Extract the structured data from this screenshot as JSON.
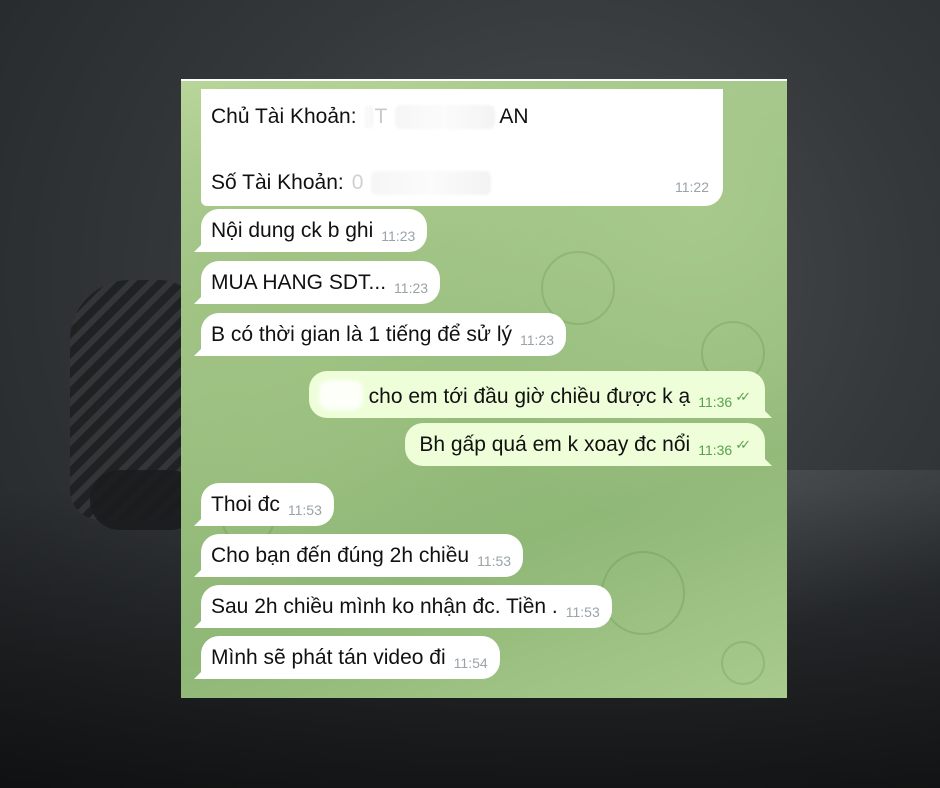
{
  "conversation": {
    "account_info": {
      "owner_label": "Chủ Tài Khoản:",
      "owner_fragment_a": "T",
      "owner_fragment_b": "AN",
      "number_label": "Số Tài Khoản:",
      "number_fragment": "0",
      "time": "11:22"
    },
    "messages": [
      {
        "direction": "in",
        "text": "Nội dung ck b ghi",
        "time": "11:23"
      },
      {
        "direction": "in",
        "text": "MUA HANG SDT...",
        "time": "11:23"
      },
      {
        "direction": "in",
        "text": "B có thời gian là 1 tiếng để sử lý",
        "time": "11:23"
      },
      {
        "direction": "out",
        "text": "cho em tới đầu giờ chiều được k ạ",
        "time": "11:36",
        "status": "read"
      },
      {
        "direction": "out",
        "text": "Bh gấp quá em k xoay đc nổi",
        "time": "11:36",
        "status": "read"
      },
      {
        "direction": "in",
        "text": "Thoi đc",
        "time": "11:53"
      },
      {
        "direction": "in",
        "text": "Cho bạn đến đúng 2h chiều",
        "time": "11:53"
      },
      {
        "direction": "in",
        "text": "Sau 2h chiều mình ko nhận đc. Tiền .",
        "time": "11:53"
      },
      {
        "direction": "in",
        "text": "Mình sẽ phát tán video đi",
        "time": "11:54"
      }
    ]
  },
  "colors": {
    "incoming_bubble": "#ffffff",
    "outgoing_bubble": "#eefed8",
    "read_check": "#5aa14f",
    "chat_background": "#a3c788"
  },
  "icons": {
    "read_receipt": "double-check-icon"
  }
}
